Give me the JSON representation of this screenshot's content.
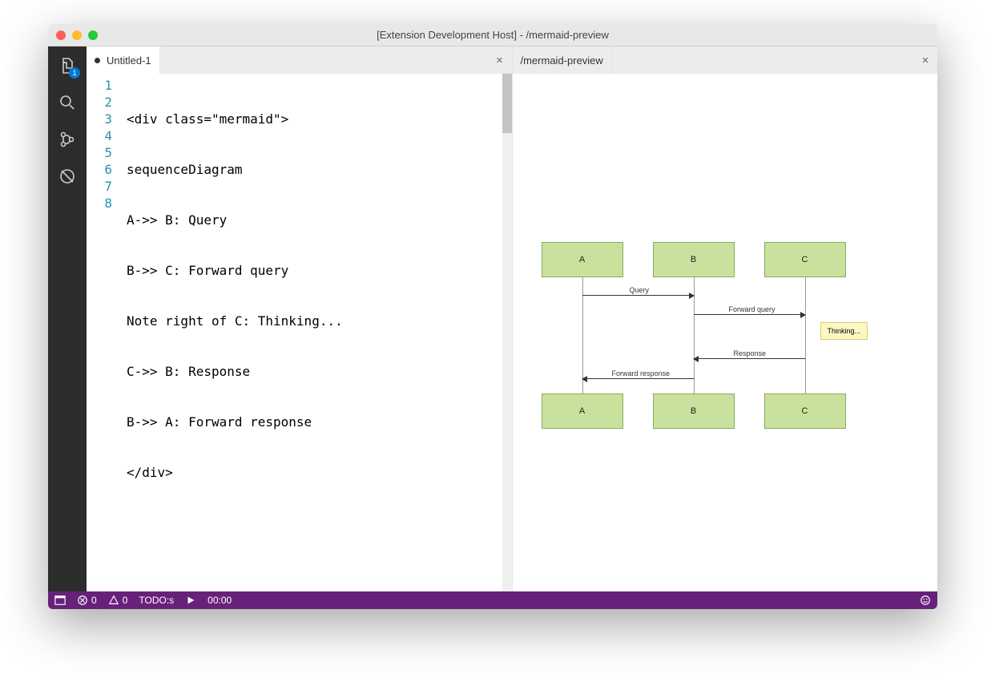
{
  "window": {
    "title": "[Extension Development Host] - /mermaid-preview"
  },
  "activitybar": {
    "explorer_badge": "1"
  },
  "editor": {
    "tab_label": "Untitled-1",
    "close_glyph": "×",
    "lines": [
      "<div class=\"mermaid\">",
      "sequenceDiagram",
      "A->> B: Query",
      "B->> C: Forward query",
      "Note right of C: Thinking...",
      "C->> B: Response",
      "B->> A: Forward response",
      "</div>"
    ],
    "line_numbers": [
      "1",
      "2",
      "3",
      "4",
      "5",
      "6",
      "7",
      "8"
    ]
  },
  "preview": {
    "tab_label": "/mermaid-preview",
    "close_glyph": "×",
    "actors": {
      "a": "A",
      "b": "B",
      "c": "C"
    },
    "messages": {
      "q": "Query",
      "fq": "Forward query",
      "resp": "Response",
      "fr": "Forward response"
    },
    "note": "Thinking..."
  },
  "statusbar": {
    "errors": "0",
    "warnings": "0",
    "todos": "TODO:s",
    "timer": "00:00"
  }
}
